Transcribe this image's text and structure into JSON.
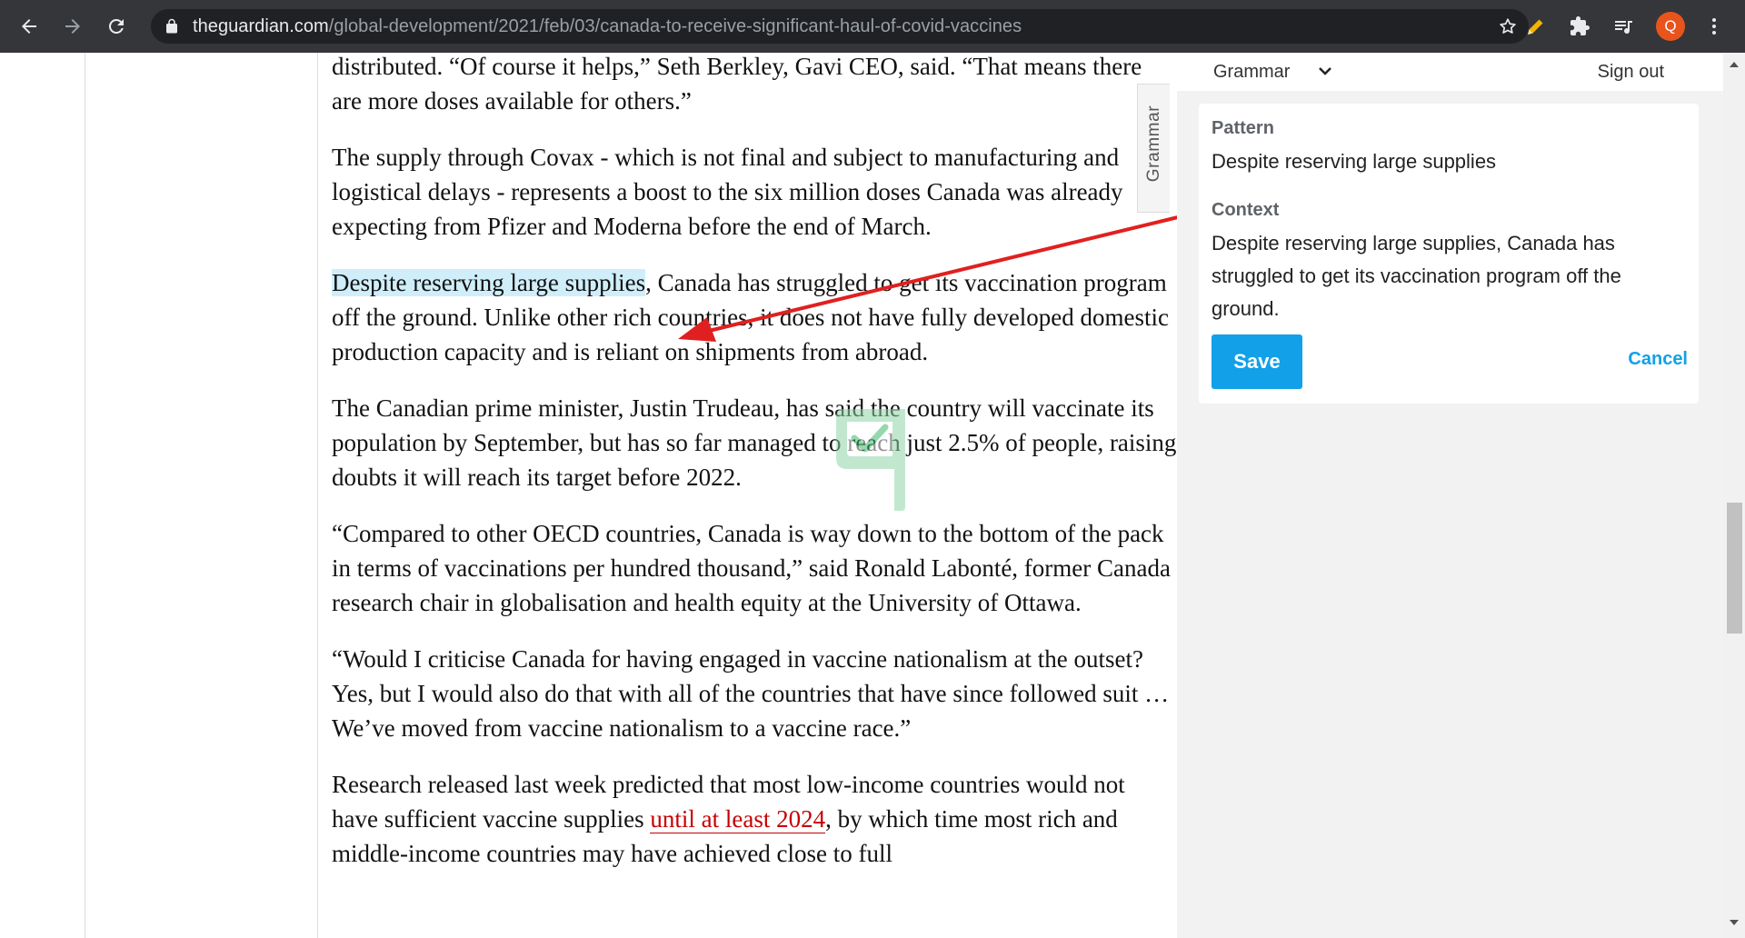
{
  "browser": {
    "url_host": "theguardian.com",
    "url_path": "/global-development/2021/feb/03/canada-to-receive-significant-haul-of-covid-vaccines",
    "profile_initial": "Q",
    "icons": [
      "back-icon",
      "forward-icon",
      "reload-icon",
      "lock-icon",
      "bookmark-star-icon",
      "pencil-extension-icon",
      "puzzle-extensions-icon",
      "media-queue-icon",
      "kebab-menu-icon"
    ]
  },
  "article": {
    "p1": "distributed. “Of course it helps,” Seth Berkley, Gavi CEO, said. “That means there are more doses available for others.”",
    "p2": "The supply through Covax - which is not final and subject to manufacturing and logistical delays - represents a boost to the six million doses Canada was already expecting from Pfizer and Moderna before the end of March.",
    "p3_highlight": "Despite reserving large supplies",
    "p3_rest": ", Canada has struggled to get its vaccination program off the ground. Unlike other rich countries, it does not have fully developed domestic production capacity and is reliant on shipments from abroad.",
    "p4": "The Canadian prime minister, Justin Trudeau, has said the country will vaccinate its population by September, but has so far managed to reach just 2.5% of people, raising doubts it will reach its target before 2022.",
    "p5": "“Compared to other OECD countries, Canada is way down to the bottom of the pack in terms of vaccinations per hundred thousand,” said Ronald Labonté, former Canada research chair in globalisation and health equity at the University of Ottawa.",
    "p6": "“Would I criticise Canada for having engaged in vaccine nationalism at the outset? Yes, but I would also do that with all of the countries that have since followed suit … We’ve moved from vaccine nationalism to a vaccine race.”",
    "p7_start": "Research released last week predicted that most low-income countries would not have sufficient vaccine supplies ",
    "p7_link": "until at least 2024",
    "p7_end": ", by which time most rich and middle-income countries may have achieved close to full"
  },
  "grammar_tab": {
    "label": "Grammar"
  },
  "panel": {
    "selector_value": "Grammar",
    "sign_out": "Sign out",
    "pattern_label": "Pattern",
    "pattern_value": "Despite reserving large supplies",
    "context_label": "Context",
    "context_value": "Despite reserving large supplies, Canada has struggled to get its vaccination program off the ground.",
    "save_label": "Save",
    "cancel_label": "Cancel"
  },
  "colors": {
    "chrome_bg": "#35363a",
    "highlight": "#cfeefa",
    "arrow": "#e02020",
    "save_button": "#12a0e8",
    "link": "#c70000",
    "avatar": "#e8541c"
  }
}
